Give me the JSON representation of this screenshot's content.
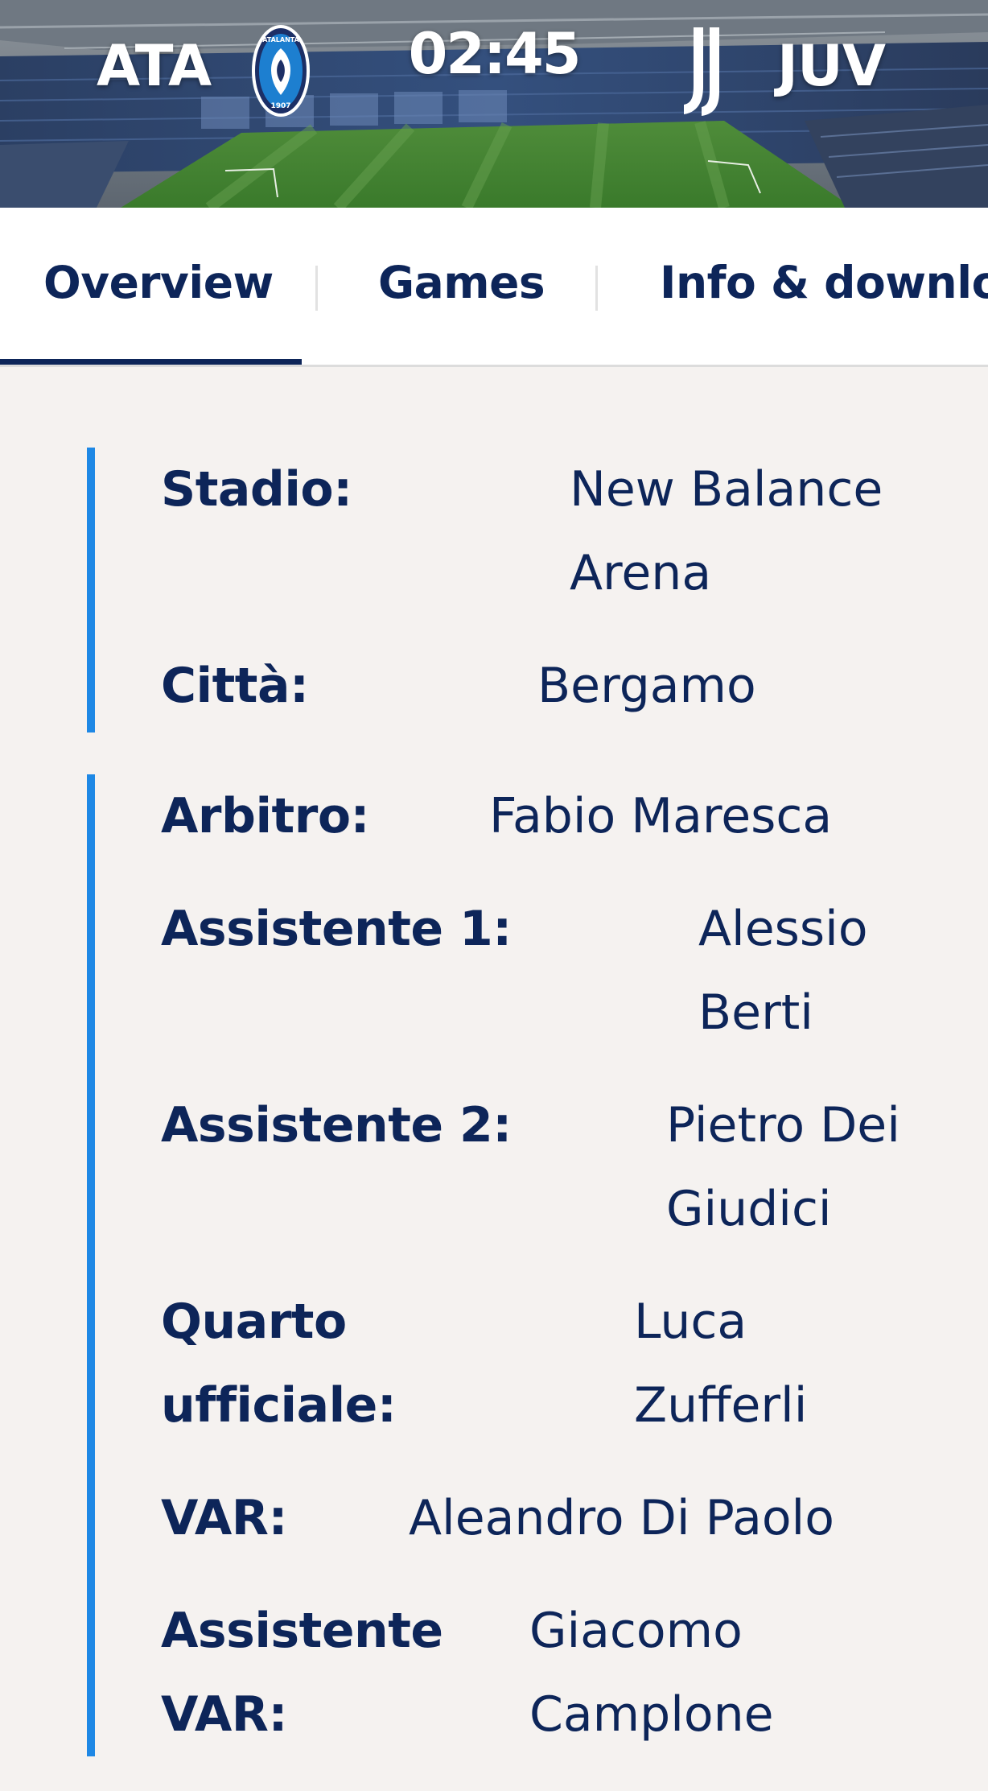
{
  "match": {
    "home_code": "ATA",
    "away_code": "JUV",
    "time": "02:45",
    "home_crest_text_top": "ATALANTA",
    "home_crest_text_bottom": "1907"
  },
  "tabs": [
    {
      "label": "Overview",
      "active": true
    },
    {
      "label": "Games",
      "active": false
    },
    {
      "label": "Info & downloa",
      "active": false
    }
  ],
  "venue": {
    "stadio_label": "Stadio:",
    "stadio_value": "New Balance Arena",
    "citta_label": "Città:",
    "citta_value": "Bergamo"
  },
  "officials": {
    "arbitro_label": "Arbitro:",
    "arbitro_value": "Fabio Maresca",
    "assistente1_label": "Assistente 1:",
    "assistente1_value": "Alessio Berti",
    "assistente2_label": "Assistente 2:",
    "assistente2_value": "Pietro Dei Giudici",
    "quarto_label": "Quarto ufficiale:",
    "quarto_value": "Luca Zufferli",
    "var_label": "VAR:",
    "var_value": "Aleandro Di Paolo",
    "assistente_var_label": "Assistente VAR:",
    "assistente_var_value": "Giacomo Camplone"
  },
  "colors": {
    "navy": "#0d2559",
    "accent_blue": "#1e88e5",
    "page_bg": "#f5f2f0"
  },
  "icons": {
    "home_crest": "atalanta-crest-icon",
    "away_crest": "juventus-crest-icon"
  }
}
